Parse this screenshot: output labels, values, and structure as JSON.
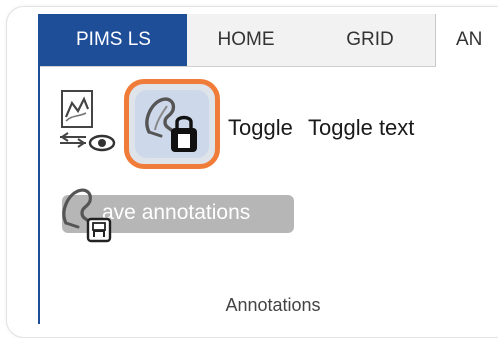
{
  "ribbon": {
    "tabs": [
      {
        "label": "PIMS LS"
      },
      {
        "label": "HOME"
      },
      {
        "label": "GRID"
      },
      {
        "label": "AN"
      }
    ],
    "active_tab_index": 3,
    "brand_color": "#1f4e99",
    "highlight_color": "#f07c3a"
  },
  "annotations_group": {
    "toggle_label": "Toggle",
    "toggle_text_label": "Toggle text",
    "save_tooltip": "ave annotations",
    "group_label": "Annotations",
    "icons": {
      "show_annotations": "annotation-eye-icon",
      "toggle_annotations": "annotation-lock-icon",
      "save_annotations": "annotation-save-icon"
    }
  }
}
